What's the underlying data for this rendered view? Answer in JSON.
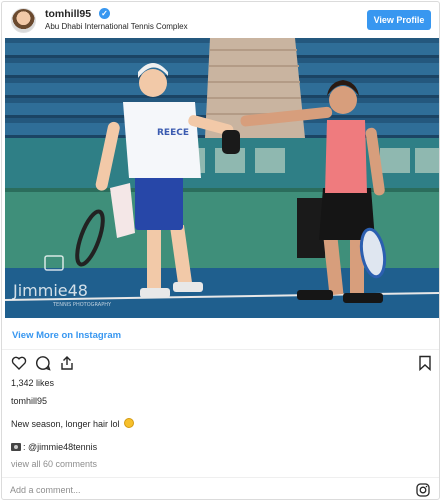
{
  "header": {
    "username": "tomhill95",
    "verified": "✓",
    "location": "Abu Dhabi International Tennis Complex",
    "view_profile_label": "View Profile"
  },
  "photo": {
    "shirt_text": "REECE",
    "watermark_main": "Jimmie48",
    "watermark_sub": "TENNIS PHOTOGRAPHY"
  },
  "view_more_label": "View More on Instagram",
  "actions": {
    "icons": [
      "heart-icon",
      "comment-icon",
      "share-icon",
      "bookmark-icon"
    ]
  },
  "likes_label": "1,342 likes",
  "caption": {
    "username": "tomhill95",
    "text": "New season, longer hair lol",
    "credit": ": @jimmie48tennis"
  },
  "view_all_comments": "view all 60 comments",
  "comment_placeholder": "Add a comment...",
  "colors": {
    "accent": "#3897f0",
    "court_green": "#3f8f7a",
    "court_blue": "#1f5f8e"
  }
}
